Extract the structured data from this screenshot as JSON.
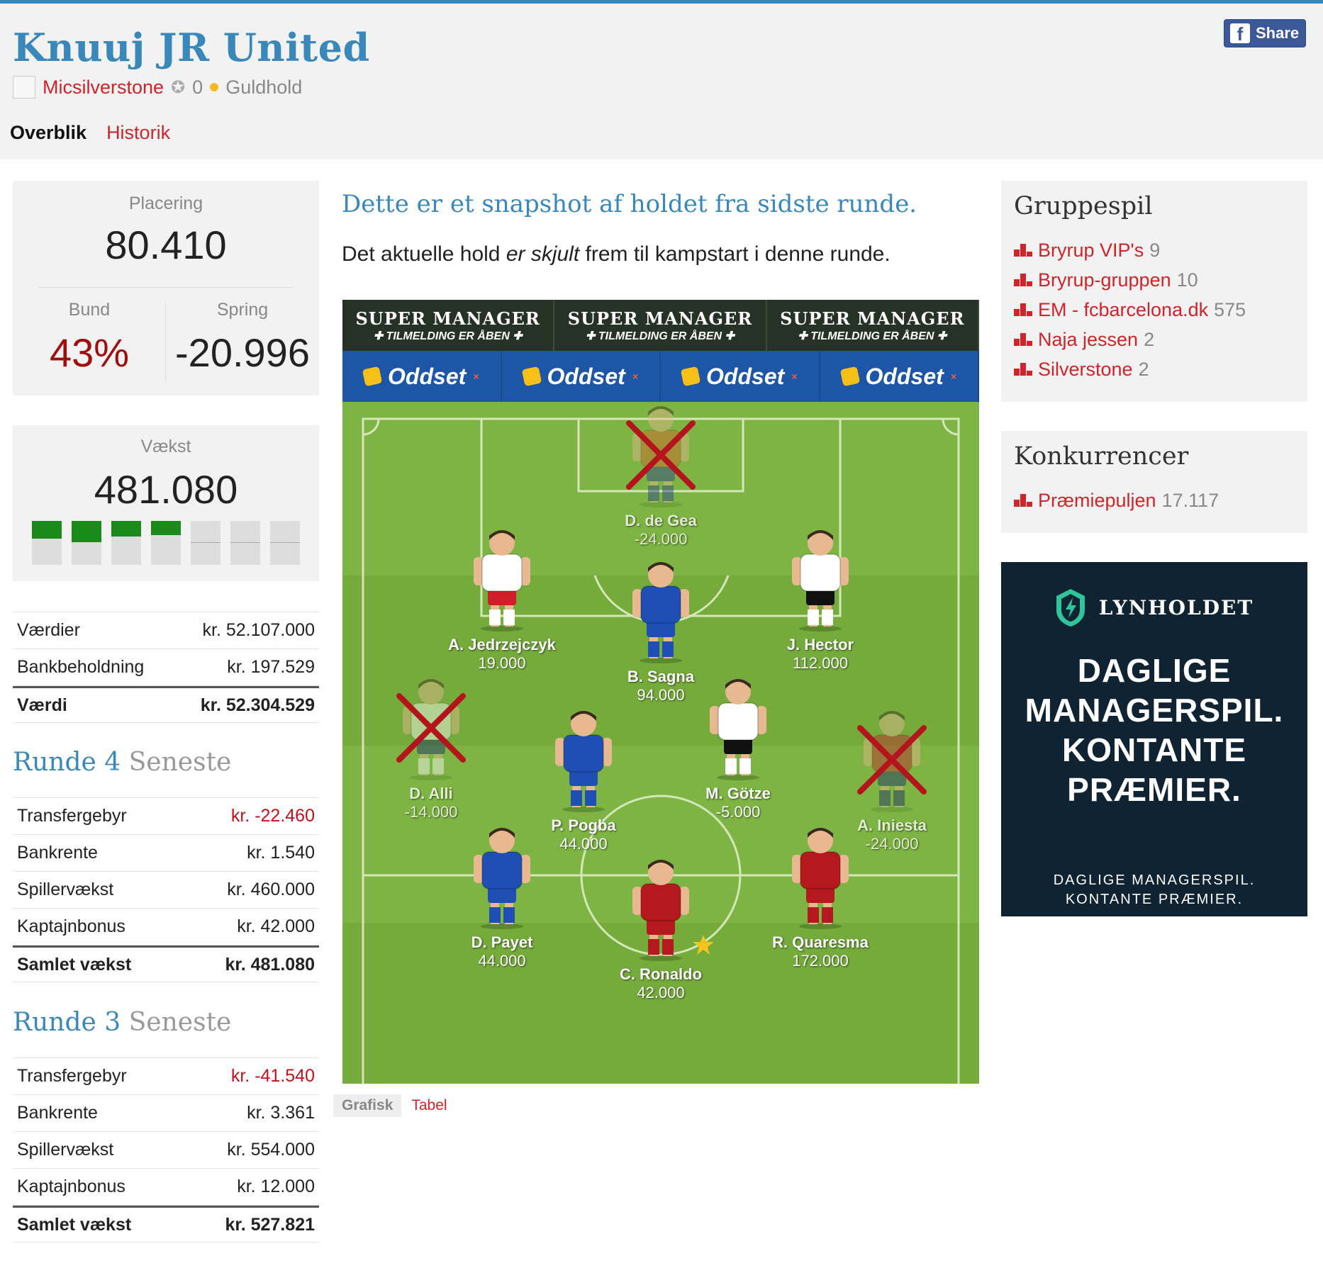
{
  "header": {
    "team_name": "Knuuj JR United",
    "username": "Micsilverstone",
    "badge_count": "0",
    "team_type": "Guldhold",
    "share_label": "Share",
    "facebook_glyph": "f",
    "tabs": [
      "Overblik",
      "Historik"
    ]
  },
  "stats": {
    "placering_label": "Placering",
    "placering": "80.410",
    "bund_label": "Bund",
    "bund": "43%",
    "spring_label": "Spring",
    "spring": "-20.996",
    "vaekst_label": "Vækst",
    "vaekst": "481.080",
    "vaekst_bars": [
      0.4,
      0.5,
      0.35,
      0.32,
      0,
      0,
      0
    ]
  },
  "values_table": [
    {
      "label": "Værdier",
      "value": "kr. 52.107.000"
    },
    {
      "label": "Bankbeholdning",
      "value": "kr. 197.529"
    },
    {
      "label": "Værdi",
      "value": "kr. 52.304.529",
      "total": true
    }
  ],
  "round4": {
    "title": "Runde 4",
    "subtitle": "Seneste",
    "rows": [
      {
        "label": "Transfergebyr",
        "value": "kr. -22.460",
        "negative": true
      },
      {
        "label": "Bankrente",
        "value": "kr. 1.540"
      },
      {
        "label": "Spillervækst",
        "value": "kr. 460.000"
      },
      {
        "label": "Kaptajnbonus",
        "value": "kr. 42.000"
      },
      {
        "label": "Samlet vækst",
        "value": "kr. 481.080",
        "total": true
      }
    ]
  },
  "round3": {
    "title": "Runde 3",
    "subtitle": "Seneste",
    "rows": [
      {
        "label": "Transfergebyr",
        "value": "kr. -41.540",
        "negative": true
      },
      {
        "label": "Bankrente",
        "value": "kr. 3.361"
      },
      {
        "label": "Spillervækst",
        "value": "kr. 554.000"
      },
      {
        "label": "Kaptajnbonus",
        "value": "kr. 12.000"
      },
      {
        "label": "Samlet vækst",
        "value": "kr. 527.821",
        "total": true
      }
    ]
  },
  "snapshot": {
    "title": "Dette er et snapshot af holdet fra sidste runde.",
    "text_before": "Det aktuelle hold ",
    "text_em": "er skjult",
    "text_after": " frem til kampstart i denne runde."
  },
  "ads": {
    "banner_title": "SUPER MANAGER",
    "banner_sub": "TILMELDING ER ÅBEN",
    "banner_flag": "✚",
    "sponsor": "Oddset",
    "sponsor_mark": "×"
  },
  "players": [
    {
      "name": "D. de Gea",
      "value": "-24.000",
      "shirt": "#d9622b",
      "shorts": "#2a3b8f",
      "out": true,
      "captain": false
    },
    {
      "name": "A. Jedrzejczyk",
      "value": "19.000",
      "shirt": "#ffffff",
      "shorts": "#d11f2a",
      "out": false,
      "captain": false
    },
    {
      "name": "B. Sagna",
      "value": "94.000",
      "shirt": "#1f4fb5",
      "shorts": "#1f4fb5",
      "out": false,
      "captain": false
    },
    {
      "name": "J. Hector",
      "value": "112.000",
      "shirt": "#ffffff",
      "shorts": "#111111",
      "out": false,
      "captain": false
    },
    {
      "name": "D. Alli",
      "value": "-14.000",
      "shirt": "#ffffff",
      "shorts": "#1a2a6a",
      "out": true,
      "captain": false
    },
    {
      "name": "P. Pogba",
      "value": "44.000",
      "shirt": "#1f4fb5",
      "shorts": "#1f4fb5",
      "out": false,
      "captain": false
    },
    {
      "name": "M. Götze",
      "value": "-5.000",
      "shirt": "#ffffff",
      "shorts": "#111111",
      "out": false,
      "captain": false
    },
    {
      "name": "A. Iniesta",
      "value": "-24.000",
      "shirt": "#c0262d",
      "shorts": "#1a2a6a",
      "out": true,
      "captain": false
    },
    {
      "name": "D. Payet",
      "value": "44.000",
      "shirt": "#1f4fb5",
      "shorts": "#1f4fb5",
      "out": false,
      "captain": false
    },
    {
      "name": "C. Ronaldo",
      "value": "42.000",
      "shirt": "#b5181e",
      "shorts": "#b5181e",
      "out": false,
      "captain": true
    },
    {
      "name": "R. Quaresma",
      "value": "172.000",
      "shirt": "#b5181e",
      "shorts": "#b5181e",
      "out": false,
      "captain": false
    }
  ],
  "view_tabs": [
    "Grafisk",
    "Tabel"
  ],
  "gruppespil": {
    "title": "Gruppespil",
    "items": [
      {
        "name": "Bryrup VIP's",
        "count": "9"
      },
      {
        "name": "Bryrup-gruppen",
        "count": "10"
      },
      {
        "name": "EM - fcbarcelona.dk",
        "count": "575"
      },
      {
        "name": "Naja jessen",
        "count": "2"
      },
      {
        "name": "Silverstone",
        "count": "2"
      }
    ]
  },
  "konkurrencer": {
    "title": "Konkurrencer",
    "items": [
      {
        "name": "Præmiepuljen",
        "count": "17.117"
      }
    ]
  },
  "lynholdet": {
    "brand": "LYNHOLDET",
    "headline": [
      "DAGLIGE",
      "MANAGERSPIL.",
      "KONTANTE",
      "PRÆMIER."
    ],
    "small": [
      "DAGLIGE MANAGERSPIL.",
      "KONTANTE PRÆMIER."
    ]
  },
  "colors": {
    "accent_blue": "#3a87b9",
    "link_red": "#d0232a",
    "negative_red": "#c1121c",
    "bar_green": "#1a8a1a",
    "pitch_green": "#7db443",
    "cross_red": "#b4141c"
  },
  "icons": [
    "facebook-icon",
    "badge-icon",
    "gold-dot-icon",
    "group-podium-icon",
    "captain-star-icon",
    "lynholdet-shield-icon",
    "oddset-coin-icon"
  ]
}
